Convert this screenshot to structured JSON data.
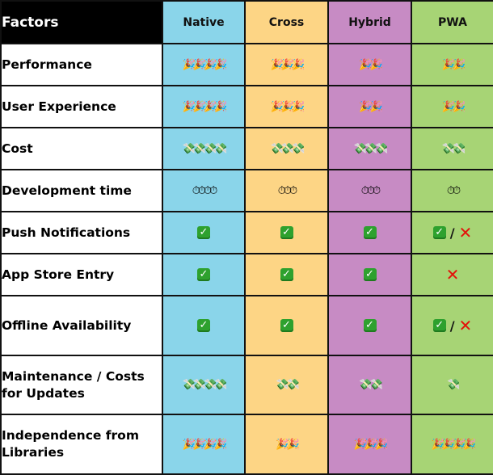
{
  "table": {
    "header": {
      "factors_label": "Factors",
      "platforms": [
        "Native",
        "Cross",
        "Hybrid",
        "PWA"
      ]
    },
    "icon_legend": {
      "party-popper-icon": "🎉",
      "money-with-wings-icon": "💸",
      "stopwatch-icon": "⏱",
      "check-mark-icon": "✓",
      "cross-mark-icon": "✕",
      "separator": "/"
    },
    "rows": [
      {
        "factor": "Performance",
        "icon": "party-popper-icon",
        "native": "🎉🎉🎉🎉",
        "cross": "🎉🎉🎉",
        "hybrid": "🎉🎉",
        "pwa": "🎉🎉",
        "counts": {
          "native": 4,
          "cross": 3,
          "hybrid": 2,
          "pwa": 2
        }
      },
      {
        "factor": "User Experience",
        "icon": "party-popper-icon",
        "native": "🎉🎉🎉🎉",
        "cross": "🎉🎉🎉",
        "hybrid": "🎉🎉",
        "pwa": "🎉🎉",
        "counts": {
          "native": 4,
          "cross": 3,
          "hybrid": 2,
          "pwa": 2
        }
      },
      {
        "factor": "Cost",
        "icon": "money-with-wings-icon",
        "native": "💸💸💸💸",
        "cross": "💸💸💸",
        "hybrid": "💸💸💸",
        "pwa": "💸💸",
        "counts": {
          "native": 4,
          "cross": 3,
          "hybrid": 3,
          "pwa": 2
        }
      },
      {
        "factor": "Development time",
        "icon": "stopwatch-icon",
        "native": "⏱⏱⏱⏱",
        "cross": "⏱⏱⏱",
        "hybrid": "⏱⏱⏱",
        "pwa": "⏱⏱",
        "counts": {
          "native": 4,
          "cross": 3,
          "hybrid": 3,
          "pwa": 2
        }
      },
      {
        "factor": "Push Notifications",
        "native": "yes",
        "cross": "yes",
        "hybrid": "yes",
        "pwa": "partial"
      },
      {
        "factor": "App Store Entry",
        "native": "yes",
        "cross": "yes",
        "hybrid": "yes",
        "pwa": "no"
      },
      {
        "factor": "Offline Availability",
        "native": "yes",
        "cross": "yes",
        "hybrid": "yes",
        "pwa": "partial"
      },
      {
        "factor": "Maintenance / Costs for Updates",
        "icon": "money-with-wings-icon",
        "native": "💸💸💸💸",
        "cross": "💸💸",
        "hybrid": "💸💸",
        "pwa": "💸",
        "counts": {
          "native": 4,
          "cross": 2,
          "hybrid": 2,
          "pwa": 1
        }
      },
      {
        "factor": "Independence from Libraries",
        "icon": "party-popper-icon",
        "native": "🎉🎉🎉🎉",
        "cross": "🎉🎉",
        "hybrid": "🎉🎉🎉",
        "pwa": "🎉🎉🎉🎉",
        "counts": {
          "native": 4,
          "cross": 2,
          "hybrid": 3,
          "pwa": 4
        }
      }
    ]
  },
  "colors": {
    "header_factor_bg": "#000000",
    "native": "#8ad5ea",
    "cross": "#fdd585",
    "hybrid": "#c78bc4",
    "pwa": "#a7d475",
    "check_green": "#2ea12e",
    "cross_red": "#e3120b"
  }
}
